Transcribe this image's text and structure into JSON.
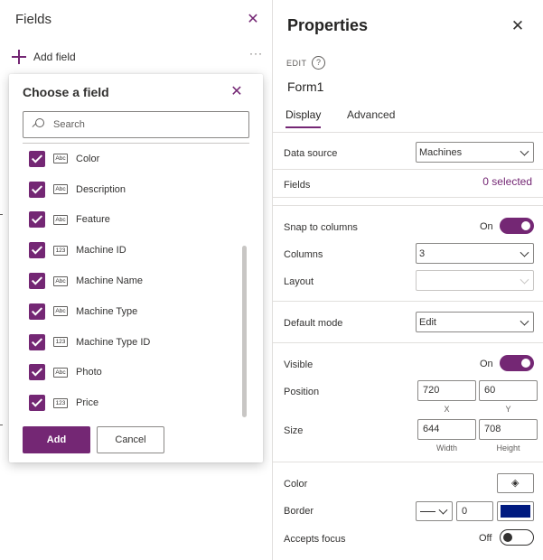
{
  "fields_pane": {
    "title": "Fields",
    "add_field_label": "Add field",
    "more_label": "···"
  },
  "chooser": {
    "title": "Choose a field",
    "search_placeholder": "Search",
    "fields": [
      {
        "type": "Abc",
        "label": "Color",
        "checked": true
      },
      {
        "type": "Abc",
        "label": "Description",
        "checked": true
      },
      {
        "type": "Abc",
        "label": "Feature",
        "checked": true
      },
      {
        "type": "123",
        "label": "Machine ID",
        "checked": true
      },
      {
        "type": "Abc",
        "label": "Machine Name",
        "checked": true
      },
      {
        "type": "Abc",
        "label": "Machine Type",
        "checked": true
      },
      {
        "type": "123",
        "label": "Machine Type ID",
        "checked": true
      },
      {
        "type": "Abc",
        "label": "Photo",
        "checked": true
      },
      {
        "type": "123",
        "label": "Price",
        "checked": true
      }
    ],
    "add_label": "Add",
    "cancel_label": "Cancel"
  },
  "properties": {
    "title": "Properties",
    "edit_label": "EDIT",
    "help_icon": "?",
    "control_name": "Form1",
    "tabs": [
      "Display",
      "Advanced"
    ],
    "active_tab": "Display",
    "data_source_label": "Data source",
    "data_source_value": "Machines",
    "fields_label": "Fields",
    "fields_selected": "0 selected",
    "snap_label": "Snap to columns",
    "snap_state": "On",
    "columns_label": "Columns",
    "columns_value": "3",
    "layout_label": "Layout",
    "layout_value": "",
    "default_mode_label": "Default mode",
    "default_mode_value": "Edit",
    "visible_label": "Visible",
    "visible_state": "On",
    "position_label": "Position",
    "position_x": "720",
    "position_y": "60",
    "x_caption": "X",
    "y_caption": "Y",
    "size_label": "Size",
    "size_width": "644",
    "size_height": "708",
    "width_caption": "Width",
    "height_caption": "Height",
    "color_label": "Color",
    "border_label": "Border",
    "border_width": "0",
    "border_color": "#001a80",
    "accepts_focus_label": "Accepts focus",
    "accepts_focus_state": "Off"
  },
  "colors": {
    "accent": "#742774",
    "border_swatch": "#001a80"
  }
}
